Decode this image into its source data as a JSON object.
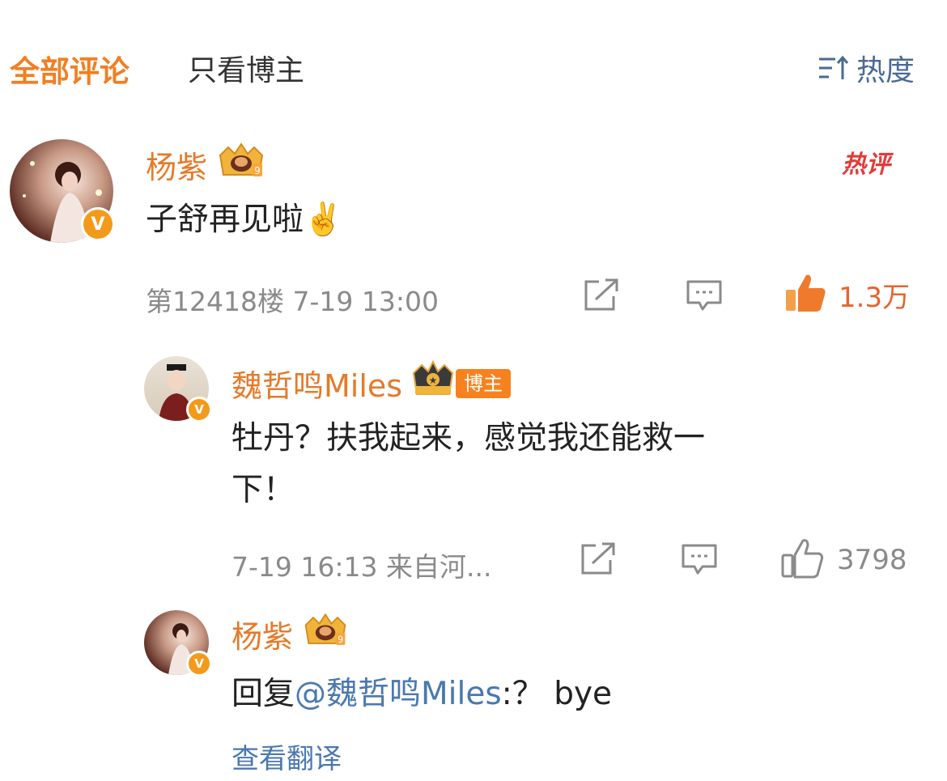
{
  "tabs": {
    "all_label": "全部评论",
    "owner_only_label": "只看博主"
  },
  "sort": {
    "label": "热度",
    "icon": "sort-icon"
  },
  "comments": [
    {
      "name": "杨紫",
      "badge_icon": "crown-rank-icon",
      "hot_label": "热评",
      "text": "子舒再见啦✌️",
      "floor_time": "第12418楼 7-19 13:00",
      "like_count": "1.3万",
      "like_active": true
    }
  ],
  "replies": [
    {
      "name": "魏哲鸣Miles",
      "owner_tag": "博主",
      "text_line1": "牡丹？扶我起来，感觉我还能救一",
      "text_line2": "下！",
      "meta": "7-19 16:13 来自河...",
      "like_count": "3798"
    },
    {
      "name": "杨紫",
      "reply_prefix": "回复",
      "mention": "@魏哲鸣Miles",
      "reply_suffix": ":？ bye",
      "translate_label": "查看翻译"
    }
  ],
  "colors": {
    "accent": "#f17f23",
    "name": "#e57a2a",
    "link": "#4a78b0",
    "like_active": "#e8632d",
    "muted": "#8a8a8a",
    "verified_badge": "#f39a1b"
  }
}
